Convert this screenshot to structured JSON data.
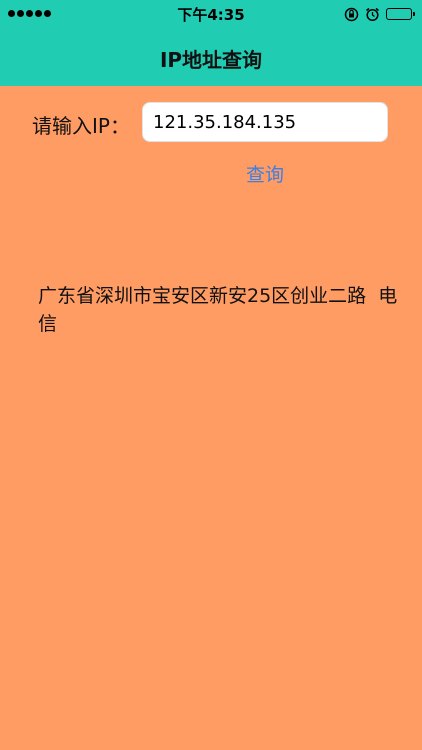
{
  "status_bar": {
    "time": "下午4:35",
    "signal_bars": 5,
    "battery_level": 0.8
  },
  "header": {
    "title": "IP地址查询"
  },
  "form": {
    "label": "请输入IP：",
    "ip_value": "121.35.184.135",
    "query_label": "查询"
  },
  "result": {
    "text": "广东省深圳市宝安区新安25区创业二路  电信"
  },
  "colors": {
    "header_bg": "#20CDB3",
    "page_bg": "#FF9C64",
    "link_blue": "#3F7FE0"
  },
  "icons": {
    "rotation_lock": "rotation-lock-icon",
    "alarm": "alarm-icon",
    "battery": "battery-icon",
    "signal": "signal-icon"
  }
}
